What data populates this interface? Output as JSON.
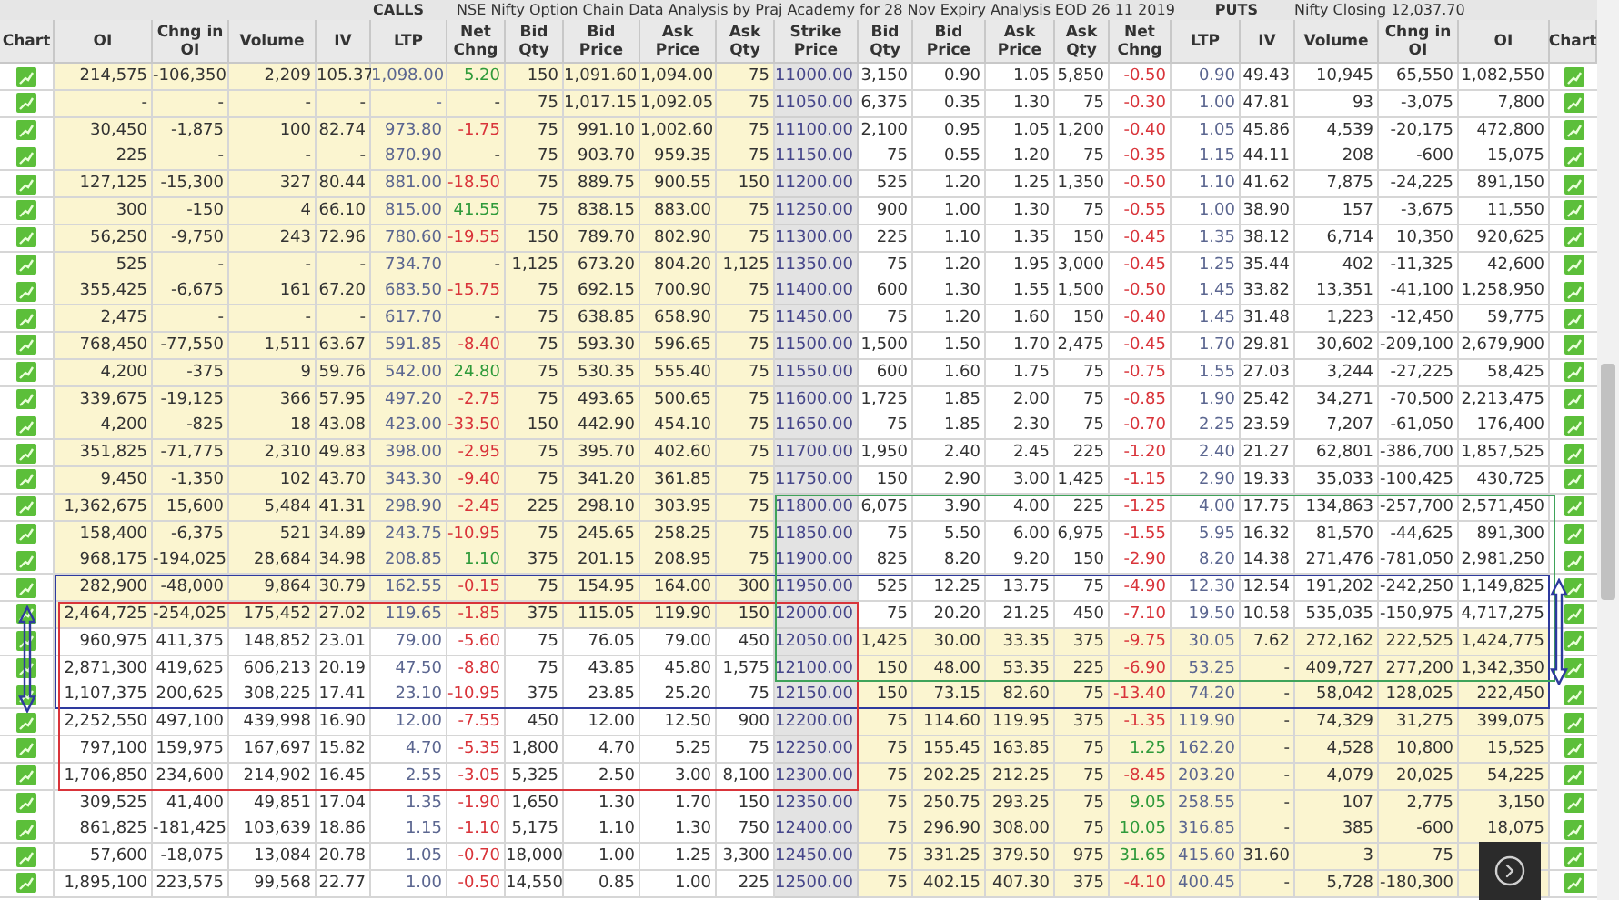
{
  "title": {
    "calls_label": "CALLS",
    "heading": "NSE Nifty Option Chain Data Analysis by Praj Academy for 28 Nov Expiry Analysis EOD 26 11 2019",
    "puts_label": "PUTS",
    "closing": "Nifty Closing 12,037.70"
  },
  "columns": [
    "Chart",
    "OI",
    "Chng in OI",
    "Volume",
    "IV",
    "LTP",
    "Net Chng",
    "Bid Qty",
    "Bid Price",
    "Ask Price",
    "Ask Qty",
    "Strike Price",
    "Bid Qty",
    "Bid Price",
    "Ask Price",
    "Ask Qty",
    "Net Chng",
    "LTP",
    "IV",
    "Volume",
    "Chng in OI",
    "OI",
    "Chart"
  ],
  "rows": [
    {
      "strike": "11000.00",
      "call": [
        "214,575",
        "-106,350",
        "2,209",
        "105.37",
        "1,098.00",
        {
          "text": "5.20",
          "color": "#2f9a3a"
        },
        "150",
        "1,091.60",
        "1,094.00",
        "75"
      ],
      "put": [
        "3,150",
        "0.90",
        "1.05",
        "5,850",
        {
          "text": "-0.50",
          "color": "#d9343a"
        },
        "0.90",
        "49.43",
        "10,945",
        "65,550",
        "1,082,550"
      ],
      "call_itm": true,
      "put_itm": false
    },
    {
      "strike": "11050.00",
      "call": [
        "-",
        "-",
        "-",
        "-",
        "-",
        "-",
        "75",
        "1,017.15",
        "1,092.05",
        "75"
      ],
      "put": [
        "6,375",
        "0.35",
        "1.30",
        "75",
        {
          "text": "-0.30",
          "color": "#d9343a"
        },
        "1.00",
        "47.81",
        "93",
        "-3,075",
        "7,800"
      ],
      "call_itm": true,
      "put_itm": false
    },
    {
      "strike": "11100.00",
      "call": [
        "30,450",
        "-1,875",
        "100",
        "82.74",
        "973.80",
        {
          "text": "-1.75",
          "color": "#d9343a"
        },
        "75",
        "991.10",
        "1,002.60",
        "75"
      ],
      "put": [
        "2,100",
        "0.95",
        "1.05",
        "1,200",
        {
          "text": "-0.40",
          "color": "#d9343a"
        },
        "1.05",
        "45.86",
        "4,539",
        "-20,175",
        "472,800"
      ],
      "call_itm": true,
      "put_itm": false
    },
    {
      "strike": "11150.00",
      "call": [
        "225",
        "-",
        "-",
        "-",
        "870.90",
        "-",
        "75",
        "903.70",
        "959.35",
        "75"
      ],
      "put": [
        "75",
        "0.55",
        "1.20",
        "75",
        {
          "text": "-0.35",
          "color": "#d9343a"
        },
        "1.15",
        "44.11",
        "208",
        "-600",
        "15,075"
      ],
      "call_itm": true,
      "put_itm": false
    },
    {
      "strike": "11200.00",
      "call": [
        "127,125",
        "-15,300",
        "327",
        "80.44",
        "881.00",
        {
          "text": "-18.50",
          "color": "#d9343a"
        },
        "75",
        "889.75",
        "900.55",
        "150"
      ],
      "put": [
        "525",
        "1.20",
        "1.25",
        "1,350",
        {
          "text": "-0.50",
          "color": "#d9343a"
        },
        "1.10",
        "41.62",
        "7,875",
        "-24,225",
        "891,150"
      ],
      "call_itm": true,
      "put_itm": false
    },
    {
      "strike": "11250.00",
      "call": [
        "300",
        "-150",
        "4",
        "66.10",
        "815.00",
        {
          "text": "41.55",
          "color": "#2f9a3a"
        },
        "75",
        "838.15",
        "883.00",
        "75"
      ],
      "put": [
        "900",
        "1.00",
        "1.30",
        "75",
        {
          "text": "-0.55",
          "color": "#d9343a"
        },
        "1.00",
        "38.90",
        "157",
        "-3,675",
        "11,550"
      ],
      "call_itm": true,
      "put_itm": false
    },
    {
      "strike": "11300.00",
      "call": [
        "56,250",
        "-9,750",
        "243",
        "72.96",
        "780.60",
        {
          "text": "-19.55",
          "color": "#d9343a"
        },
        "150",
        "789.70",
        "802.90",
        "75"
      ],
      "put": [
        "225",
        "1.10",
        "1.35",
        "150",
        {
          "text": "-0.45",
          "color": "#d9343a"
        },
        "1.35",
        "38.12",
        "6,714",
        "10,350",
        "920,625"
      ],
      "call_itm": true,
      "put_itm": false
    },
    {
      "strike": "11350.00",
      "call": [
        "525",
        "-",
        "-",
        "-",
        "734.70",
        "-",
        "1,125",
        "673.20",
        "804.20",
        "1,125"
      ],
      "put": [
        "75",
        "1.20",
        "1.95",
        "3,000",
        {
          "text": "-0.45",
          "color": "#d9343a"
        },
        "1.25",
        "35.44",
        "402",
        "-11,325",
        "42,600"
      ],
      "call_itm": true,
      "put_itm": false
    },
    {
      "strike": "11400.00",
      "call": [
        "355,425",
        "-6,675",
        "161",
        "67.20",
        "683.50",
        {
          "text": "-15.75",
          "color": "#d9343a"
        },
        "75",
        "692.15",
        "700.90",
        "75"
      ],
      "put": [
        "600",
        "1.30",
        "1.55",
        "1,500",
        {
          "text": "-0.50",
          "color": "#d9343a"
        },
        "1.45",
        "33.82",
        "13,351",
        "-41,100",
        "1,258,950"
      ],
      "call_itm": true,
      "put_itm": false
    },
    {
      "strike": "11450.00",
      "call": [
        "2,475",
        "-",
        "-",
        "-",
        "617.70",
        "-",
        "75",
        "638.85",
        "658.90",
        "75"
      ],
      "put": [
        "75",
        "1.20",
        "1.60",
        "150",
        {
          "text": "-0.40",
          "color": "#d9343a"
        },
        "1.45",
        "31.48",
        "1,223",
        "-12,450",
        "59,775"
      ],
      "call_itm": true,
      "put_itm": false
    },
    {
      "strike": "11500.00",
      "call": [
        "768,450",
        "-77,550",
        "1,511",
        "63.67",
        "591.85",
        {
          "text": "-8.40",
          "color": "#d9343a"
        },
        "75",
        "593.30",
        "596.65",
        "75"
      ],
      "put": [
        "1,500",
        "1.50",
        "1.70",
        "2,475",
        {
          "text": "-0.45",
          "color": "#d9343a"
        },
        "1.70",
        "29.81",
        "30,602",
        "-209,100",
        "2,679,900"
      ],
      "call_itm": true,
      "put_itm": false
    },
    {
      "strike": "11550.00",
      "call": [
        "4,200",
        "-375",
        "9",
        "59.76",
        "542.00",
        {
          "text": "24.80",
          "color": "#2f9a3a"
        },
        "75",
        "530.35",
        "555.40",
        "75"
      ],
      "put": [
        "600",
        "1.60",
        "1.75",
        "75",
        {
          "text": "-0.75",
          "color": "#d9343a"
        },
        "1.55",
        "27.03",
        "3,244",
        "-27,225",
        "58,425"
      ],
      "call_itm": true,
      "put_itm": false
    },
    {
      "strike": "11600.00",
      "call": [
        "339,675",
        "-19,125",
        "366",
        "57.95",
        "497.20",
        {
          "text": "-2.75",
          "color": "#d9343a"
        },
        "75",
        "493.65",
        "500.65",
        "75"
      ],
      "put": [
        "1,725",
        "1.85",
        "2.00",
        "75",
        {
          "text": "-0.85",
          "color": "#d9343a"
        },
        "1.90",
        "25.42",
        "34,271",
        "-70,500",
        "2,213,475"
      ],
      "call_itm": true,
      "put_itm": false
    },
    {
      "strike": "11650.00",
      "call": [
        "4,200",
        "-825",
        "18",
        "43.08",
        "423.00",
        {
          "text": "-33.50",
          "color": "#d9343a"
        },
        "150",
        "442.90",
        "454.10",
        "75"
      ],
      "put": [
        "75",
        "1.85",
        "2.30",
        "75",
        {
          "text": "-0.70",
          "color": "#d9343a"
        },
        "2.25",
        "23.59",
        "7,207",
        "-61,050",
        "176,400"
      ],
      "call_itm": true,
      "put_itm": false
    },
    {
      "strike": "11700.00",
      "call": [
        "351,825",
        "-71,775",
        "2,310",
        "49.83",
        "398.00",
        {
          "text": "-2.95",
          "color": "#d9343a"
        },
        "75",
        "395.70",
        "402.60",
        "75"
      ],
      "put": [
        "1,950",
        "2.40",
        "2.45",
        "225",
        {
          "text": "-1.20",
          "color": "#d9343a"
        },
        "2.40",
        "21.27",
        "62,801",
        "-386,700",
        "1,857,525"
      ],
      "call_itm": true,
      "put_itm": false
    },
    {
      "strike": "11750.00",
      "call": [
        "9,450",
        "-1,350",
        "102",
        "43.70",
        "343.30",
        {
          "text": "-9.40",
          "color": "#d9343a"
        },
        "75",
        "341.20",
        "361.85",
        "75"
      ],
      "put": [
        "150",
        "2.90",
        "3.00",
        "1,425",
        {
          "text": "-1.15",
          "color": "#d9343a"
        },
        "2.90",
        "19.33",
        "35,033",
        "-100,425",
        "430,725"
      ],
      "call_itm": true,
      "put_itm": false
    },
    {
      "strike": "11800.00",
      "call": [
        "1,362,675",
        "15,600",
        "5,484",
        "41.31",
        "298.90",
        {
          "text": "-2.45",
          "color": "#d9343a"
        },
        "225",
        "298.10",
        "303.95",
        "75"
      ],
      "put": [
        "6,075",
        "3.90",
        "4.00",
        "225",
        {
          "text": "-1.25",
          "color": "#d9343a"
        },
        "4.00",
        "17.75",
        "134,863",
        "-257,700",
        "2,571,450"
      ],
      "call_itm": true,
      "put_itm": false
    },
    {
      "strike": "11850.00",
      "call": [
        "158,400",
        "-6,375",
        "521",
        "34.89",
        "243.75",
        {
          "text": "-10.95",
          "color": "#d9343a"
        },
        "75",
        "245.65",
        "258.25",
        "75"
      ],
      "put": [
        "75",
        "5.50",
        "6.00",
        "6,975",
        {
          "text": "-1.55",
          "color": "#d9343a"
        },
        "5.95",
        "16.32",
        "81,570",
        "-44,625",
        "891,300"
      ],
      "call_itm": true,
      "put_itm": false
    },
    {
      "strike": "11900.00",
      "call": [
        "968,175",
        "-194,025",
        "28,684",
        "34.98",
        "208.85",
        {
          "text": "1.10",
          "color": "#2f9a3a"
        },
        "375",
        "201.15",
        "208.95",
        "75"
      ],
      "put": [
        "825",
        "8.20",
        "9.20",
        "150",
        {
          "text": "-2.90",
          "color": "#d9343a"
        },
        "8.20",
        "14.38",
        "271,476",
        "-781,050",
        "2,981,250"
      ],
      "call_itm": true,
      "put_itm": false
    },
    {
      "strike": "11950.00",
      "call": [
        "282,900",
        "-48,000",
        "9,864",
        "30.79",
        "162.55",
        {
          "text": "-0.15",
          "color": "#d9343a"
        },
        "75",
        "154.95",
        "164.00",
        "300"
      ],
      "put": [
        "525",
        "12.25",
        "13.75",
        "75",
        {
          "text": "-4.90",
          "color": "#d9343a"
        },
        "12.30",
        "12.54",
        "191,202",
        "-242,250",
        "1,149,825"
      ],
      "call_itm": true,
      "put_itm": false
    },
    {
      "strike": "12000.00",
      "call": [
        "2,464,725",
        "-254,025",
        "175,452",
        "27.02",
        "119.65",
        {
          "text": "-1.85",
          "color": "#d9343a"
        },
        "375",
        "115.05",
        "119.90",
        "150"
      ],
      "put": [
        "75",
        "20.20",
        "21.25",
        "450",
        {
          "text": "-7.10",
          "color": "#d9343a"
        },
        "19.50",
        "10.58",
        "535,035",
        "-150,975",
        "4,717,275"
      ],
      "call_itm": true,
      "put_itm": false
    },
    {
      "strike": "12050.00",
      "call": [
        "960,975",
        "411,375",
        "148,852",
        "23.01",
        "79.00",
        {
          "text": "-5.60",
          "color": "#d9343a"
        },
        "75",
        "76.05",
        "79.00",
        "450"
      ],
      "put": [
        "1,425",
        "30.00",
        "33.35",
        "375",
        {
          "text": "-9.75",
          "color": "#d9343a"
        },
        "30.05",
        "7.62",
        "272,162",
        "222,525",
        "1,424,775"
      ],
      "call_itm": false,
      "put_itm": true
    },
    {
      "strike": "12100.00",
      "call": [
        "2,871,300",
        "419,625",
        "606,213",
        "20.19",
        "47.50",
        {
          "text": "-8.80",
          "color": "#d9343a"
        },
        "75",
        "43.85",
        "45.80",
        "1,575"
      ],
      "put": [
        "150",
        "48.00",
        "53.35",
        "225",
        {
          "text": "-6.90",
          "color": "#d9343a"
        },
        "53.25",
        "-",
        "409,727",
        "277,200",
        "1,342,350"
      ],
      "call_itm": false,
      "put_itm": true
    },
    {
      "strike": "12150.00",
      "call": [
        "1,107,375",
        "200,625",
        "308,225",
        "17.41",
        "23.10",
        {
          "text": "-10.95",
          "color": "#d9343a"
        },
        "375",
        "23.85",
        "25.20",
        "75"
      ],
      "put": [
        "150",
        "73.15",
        "82.60",
        "75",
        {
          "text": "-13.40",
          "color": "#d9343a"
        },
        "74.20",
        "-",
        "58,042",
        "128,025",
        "222,450"
      ],
      "call_itm": false,
      "put_itm": true
    },
    {
      "strike": "12200.00",
      "call": [
        "2,252,550",
        "497,100",
        "439,998",
        "16.90",
        "12.00",
        {
          "text": "-7.55",
          "color": "#d9343a"
        },
        "450",
        "12.00",
        "12.50",
        "900"
      ],
      "put": [
        "75",
        "114.60",
        "119.95",
        "375",
        {
          "text": "-1.35",
          "color": "#d9343a"
        },
        "119.90",
        "-",
        "74,329",
        "31,275",
        "399,075"
      ],
      "call_itm": false,
      "put_itm": true
    },
    {
      "strike": "12250.00",
      "call": [
        "797,100",
        "159,975",
        "167,697",
        "15.82",
        "4.70",
        {
          "text": "-5.35",
          "color": "#d9343a"
        },
        "1,800",
        "4.70",
        "5.25",
        "75"
      ],
      "put": [
        "75",
        "155.45",
        "163.85",
        "75",
        {
          "text": "1.25",
          "color": "#2f9a3a"
        },
        "162.20",
        "-",
        "4,528",
        "10,800",
        "15,525"
      ],
      "call_itm": false,
      "put_itm": true
    },
    {
      "strike": "12300.00",
      "call": [
        "1,706,850",
        "234,600",
        "214,902",
        "16.45",
        "2.55",
        {
          "text": "-3.05",
          "color": "#d9343a"
        },
        "5,325",
        "2.50",
        "3.00",
        "8,100"
      ],
      "put": [
        "75",
        "202.25",
        "212.25",
        "75",
        {
          "text": "-8.45",
          "color": "#d9343a"
        },
        "203.20",
        "-",
        "4,079",
        "20,025",
        "54,225"
      ],
      "call_itm": false,
      "put_itm": true
    },
    {
      "strike": "12350.00",
      "call": [
        "309,525",
        "41,400",
        "49,851",
        "17.04",
        "1.35",
        {
          "text": "-1.90",
          "color": "#d9343a"
        },
        "1,650",
        "1.30",
        "1.70",
        "150"
      ],
      "put": [
        "75",
        "250.75",
        "293.25",
        "75",
        {
          "text": "9.05",
          "color": "#2f9a3a"
        },
        "258.55",
        "-",
        "107",
        "2,775",
        "3,150"
      ],
      "call_itm": false,
      "put_itm": true
    },
    {
      "strike": "12400.00",
      "call": [
        "861,825",
        "-181,425",
        "103,639",
        "18.86",
        "1.15",
        {
          "text": "-1.10",
          "color": "#d9343a"
        },
        "5,175",
        "1.10",
        "1.30",
        "750"
      ],
      "put": [
        "75",
        "296.90",
        "308.00",
        "75",
        {
          "text": "10.05",
          "color": "#2f9a3a"
        },
        "316.85",
        "-",
        "385",
        "-600",
        "18,075"
      ],
      "call_itm": false,
      "put_itm": true
    },
    {
      "strike": "12450.00",
      "call": [
        "57,600",
        "-18,075",
        "13,084",
        "20.78",
        "1.05",
        {
          "text": "-0.70",
          "color": "#d9343a"
        },
        "18,000",
        "1.00",
        "1.25",
        "3,300"
      ],
      "put": [
        "75",
        "331.25",
        "379.50",
        "975",
        {
          "text": "31.65",
          "color": "#2f9a3a"
        },
        "415.60",
        "31.60",
        "3",
        "75"
      ],
      "call_itm": false,
      "put_itm": true
    },
    {
      "strike": "12500.00",
      "call": [
        "1,895,100",
        "223,575",
        "99,568",
        "22.77",
        "1.00",
        {
          "text": "-0.50",
          "color": "#d9343a"
        },
        "14,550",
        "0.85",
        "1.00",
        "225"
      ],
      "put": [
        "75",
        "402.15",
        "407.30",
        "375",
        {
          "text": "-4.10",
          "color": "#d9343a"
        },
        "400.45",
        "-",
        "5,728",
        "-180,300"
      ],
      "call_itm": false,
      "put_itm": true
    }
  ]
}
